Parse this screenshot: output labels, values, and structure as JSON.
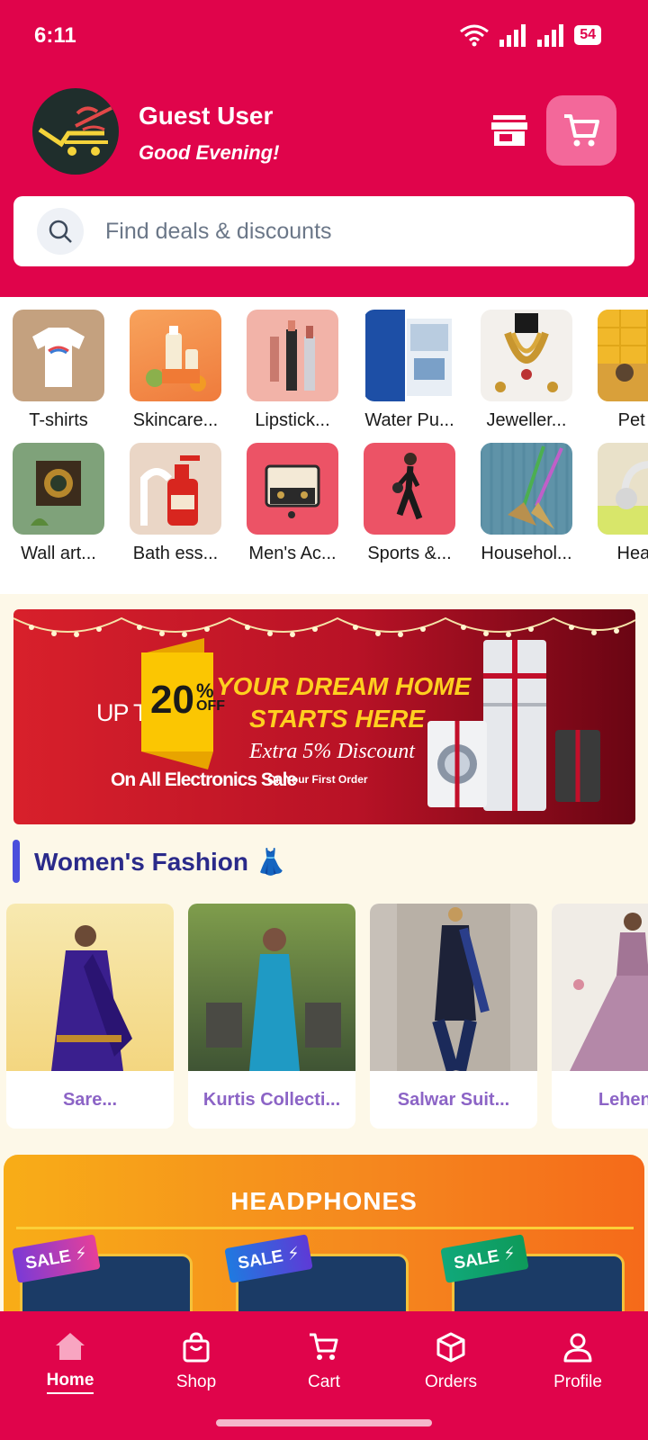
{
  "status_bar": {
    "time": "6:11",
    "battery": "54"
  },
  "header": {
    "user_name": "Guest User",
    "greeting": "Good Evening!",
    "search_placeholder": "Find deals & discounts"
  },
  "categories_row1": [
    {
      "label": "T-shirts",
      "icon": "tshirt-image"
    },
    {
      "label": "Skincare...",
      "icon": "skincare-image"
    },
    {
      "label": "Lipstick...",
      "icon": "lipstick-image"
    },
    {
      "label": "Water Pu...",
      "icon": "water-purifier-image"
    },
    {
      "label": "Jeweller...",
      "icon": "jewellery-image"
    },
    {
      "label": "Pet ac",
      "icon": "pet-image"
    }
  ],
  "categories_row2": [
    {
      "label": "Wall art...",
      "icon": "wall-art-image"
    },
    {
      "label": "Bath ess...",
      "icon": "bath-image"
    },
    {
      "label": "Men's Ac...",
      "icon": "mens-accessories-image"
    },
    {
      "label": "Sports &...",
      "icon": "sports-image"
    },
    {
      "label": "Househol...",
      "icon": "household-image"
    },
    {
      "label": "Headp",
      "icon": "headphones-image"
    }
  ],
  "banner": {
    "upto": "UP TO",
    "percent": "20",
    "off_symbol": "%",
    "off_text": "OFF",
    "headline_1": "YOUR DREAM HOME",
    "headline_2": "STARTS HERE",
    "extra": "Extra 5% Discount",
    "sale": "On All Electronics Sale",
    "first_order": "On Your First Order"
  },
  "womens_fashion": {
    "title": "Women's Fashion 👗",
    "items": [
      {
        "label": "Sare..."
      },
      {
        "label": "Kurtis Collecti..."
      },
      {
        "label": "Salwar Suit..."
      },
      {
        "label": "Lehenga"
      }
    ]
  },
  "headphones": {
    "title": "HEADPHONES",
    "tags": [
      "SALE ⚡",
      "SALE ⚡",
      "SALE ⚡"
    ]
  },
  "bottom_nav": [
    {
      "label": "Home",
      "icon": "home-icon"
    },
    {
      "label": "Shop",
      "icon": "shopping-bag-icon"
    },
    {
      "label": "Cart",
      "icon": "cart-icon"
    },
    {
      "label": "Orders",
      "icon": "package-icon"
    },
    {
      "label": "Profile",
      "icon": "user-icon"
    }
  ],
  "colors": {
    "brand": "#e0044b",
    "accent": "#f3689a",
    "section_title": "#2a2a8a",
    "fashion_label": "#8c64c6"
  }
}
